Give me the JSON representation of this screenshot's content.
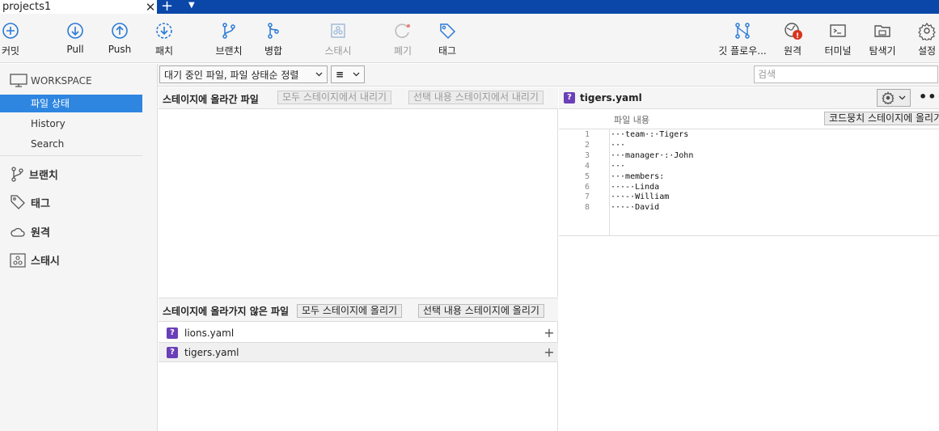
{
  "tab": {
    "title": "projects1",
    "close": "✕",
    "add": "+",
    "menu": "▼"
  },
  "toolbar": {
    "commit": "커밋",
    "pull": "Pull",
    "push": "Push",
    "patch": "패치",
    "branch": "브랜치",
    "merge": "병합",
    "stash": "스태시",
    "discard": "폐기",
    "tag": "태그",
    "gitflow": "깃 플로우...",
    "remote": "원격",
    "terminal": "터미널",
    "explorer": "탐색기",
    "settings": "설정",
    "remote_badge": "!"
  },
  "sidebar": {
    "workspace": "WORKSPACE",
    "items": [
      "파일 상태",
      "History",
      "Search"
    ],
    "groups": [
      "브랜치",
      "태그",
      "원격",
      "스태시"
    ]
  },
  "filter": {
    "dropdown": "대기 중인 파일, 파일 상태순 정렬",
    "view_icon": "≡",
    "search_placeholder": "검색"
  },
  "staged": {
    "title": "스테이지에 올라간 파일",
    "unstage_all": "모두 스테이지에서 내리기",
    "unstage_selected": "선택 내용 스테이지에서 내리기"
  },
  "unstaged": {
    "title": "스테이지에 올라가지 않은 파일",
    "stage_all": "모두 스테이지에 올리기",
    "stage_selected": "선택 내용 스테이지에 올리기",
    "files": [
      {
        "name": "lions.yaml",
        "status": "?"
      },
      {
        "name": "tigers.yaml",
        "status": "?"
      }
    ]
  },
  "diff": {
    "file": "tigers.yaml",
    "status": "?",
    "hunk_label": "파일 내용",
    "stage_hunk": "코드뭉치 스테이지에 올리기",
    "more": "•••",
    "lines": [
      {
        "n": "1",
        "text": "···team·:·Tigers"
      },
      {
        "n": "2",
        "text": "···"
      },
      {
        "n": "3",
        "text": "···manager·:·John"
      },
      {
        "n": "4",
        "text": "···"
      },
      {
        "n": "5",
        "text": "···members:"
      },
      {
        "n": "6",
        "text": "···-·Linda"
      },
      {
        "n": "7",
        "text": "···-·William"
      },
      {
        "n": "8",
        "text": "···-·David"
      }
    ]
  }
}
